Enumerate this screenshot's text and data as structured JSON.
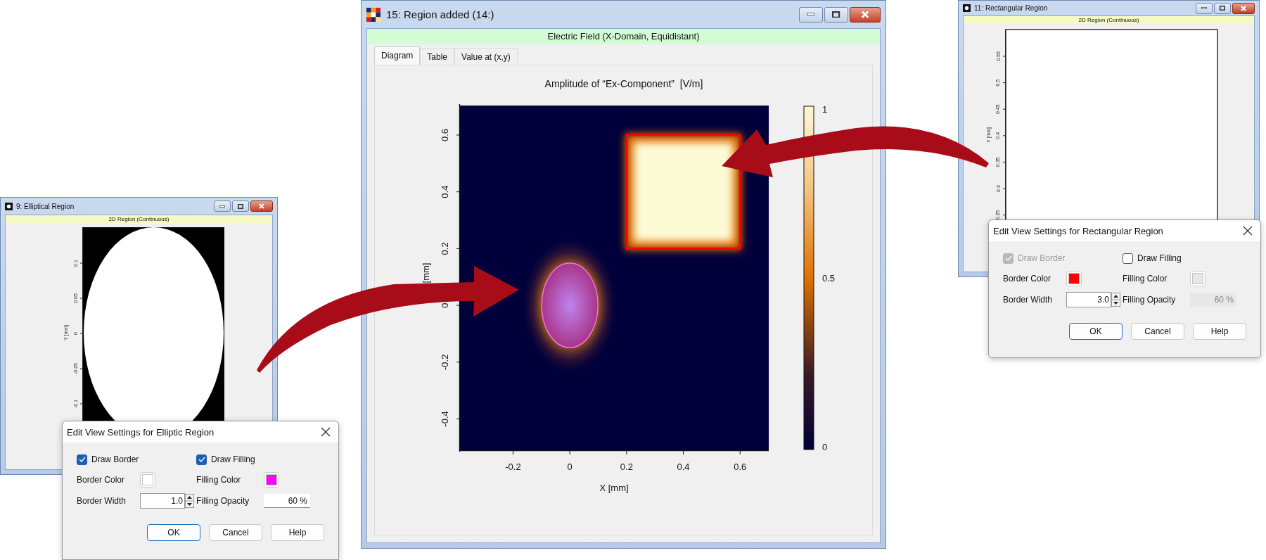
{
  "elliptical_window": {
    "title": "9: Elliptical Region",
    "subtitle": "2D Region (Continuous)",
    "y_label": "Y [mm]",
    "y_ticks": [
      "0.1",
      "0.05",
      "0",
      "-0.05",
      "-0.1"
    ]
  },
  "elliptic_dialog": {
    "title": "Edit View Settings for Elliptic Region",
    "draw_border": {
      "label": "Draw Border",
      "checked": true,
      "disabled": false
    },
    "draw_filling": {
      "label": "Draw Filling",
      "checked": true,
      "disabled": false
    },
    "border_color": {
      "label": "Border Color",
      "color": "#ffffff"
    },
    "filling_color": {
      "label": "Filling Color",
      "color": "#ff00ff"
    },
    "border_width": {
      "label": "Border Width",
      "value": "1.0"
    },
    "filling_opacity": {
      "label": "Filling Opacity",
      "value": "60 %",
      "disabled": false
    },
    "buttons": [
      {
        "label": "OK",
        "default": true
      },
      {
        "label": "Cancel",
        "default": false
      },
      {
        "label": "Help",
        "default": false
      }
    ]
  },
  "main_window": {
    "title": "15: Region added (14:)",
    "subtitle": "Electric Field (X-Domain, Equidistant)",
    "tabs": [
      {
        "label": "Diagram",
        "selected": true
      },
      {
        "label": "Table",
        "selected": false
      },
      {
        "label": "Value at (x,y)",
        "selected": false
      }
    ],
    "plot": {
      "title": "Amplitude of “Ex-Component”  [V/m]",
      "y_label": "[mm]",
      "x_label": "X [mm]",
      "y_ticks": [
        "0.6",
        "0.4",
        "0.2",
        "0",
        "-0.2",
        "-0.4"
      ],
      "x_ticks": [
        "-0.2",
        "0",
        "0.2",
        "0.4",
        "0.6"
      ],
      "colorbar_ticks": [
        "1",
        "0.5",
        "0"
      ]
    }
  },
  "rectangular_window": {
    "title": "11: Rectangular Region",
    "subtitle": "2D Region (Continuous)",
    "y_label": "Y [mm]",
    "y_ticks": [
      "0.55",
      "0.5",
      "0.45",
      "0.4",
      "0.35",
      "0.3",
      "0.25"
    ]
  },
  "rectangular_dialog": {
    "title": "Edit View Settings for Rectangular Region",
    "draw_border": {
      "label": "Draw Border",
      "checked": true,
      "disabled": true
    },
    "draw_filling": {
      "label": "Draw Filling",
      "checked": false,
      "disabled": false
    },
    "border_color": {
      "label": "Border Color",
      "color": "#ff0000"
    },
    "filling_color": {
      "label": "Filling Color",
      "color": "#e6e6e6"
    },
    "border_width": {
      "label": "Border Width",
      "value": "3.0"
    },
    "filling_opacity": {
      "label": "Filling Opacity",
      "value": "60 %",
      "disabled": true
    },
    "buttons": [
      {
        "label": "OK",
        "default": true
      },
      {
        "label": "Cancel",
        "default": false
      },
      {
        "label": "Help",
        "default": false
      }
    ]
  }
}
